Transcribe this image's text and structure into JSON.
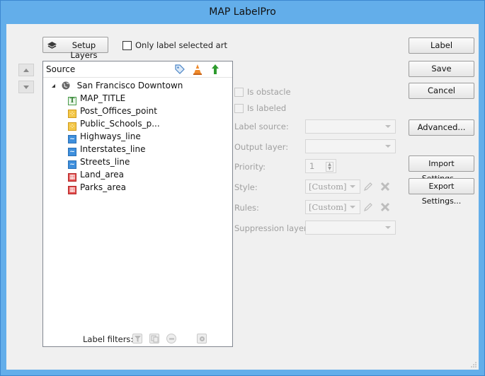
{
  "window": {
    "title": "MAP LabelPro"
  },
  "top": {
    "setup_layers_label": "Setup Layers",
    "only_selected_label": "Only label selected art"
  },
  "tree": {
    "header_label": "Source",
    "root": "San Francisco Downtown",
    "layers": [
      {
        "name": "MAP_TITLE",
        "type": "text-layer-icon"
      },
      {
        "name": "Post_Offices_point",
        "type": "point-layer-icon"
      },
      {
        "name": "Public_Schools_p...",
        "type": "point-layer-icon"
      },
      {
        "name": "Highways_line",
        "type": "line-layer-icon"
      },
      {
        "name": "Interstates_line",
        "type": "line-layer-icon"
      },
      {
        "name": "Streets_line",
        "type": "line-layer-icon"
      },
      {
        "name": "Land_area",
        "type": "area-layer-icon"
      },
      {
        "name": "Parks_area",
        "type": "area-layer-icon"
      }
    ]
  },
  "props": {
    "is_obstacle": "Is obstacle",
    "is_labeled": "Is labeled",
    "label_source": "Label source:",
    "output_layer": "Output layer:",
    "priority": "Priority:",
    "priority_value": "1",
    "style": "Style:",
    "style_value": "[Custom]",
    "rules": "Rules:",
    "rules_value": "[Custom]",
    "suppression_layer": "Suppression layer:"
  },
  "buttons": {
    "label": "Label",
    "save": "Save",
    "cancel": "Cancel",
    "advanced": "Advanced...",
    "import": "Import Settings...",
    "export": "Export Settings..."
  },
  "footer": {
    "label_filters": "Label filters:"
  },
  "colors": {
    "title_bar": "#63aeea",
    "client_bg": "#f0f0f0",
    "layer_up_green": "#2e9b2e",
    "globe": "#666666"
  }
}
